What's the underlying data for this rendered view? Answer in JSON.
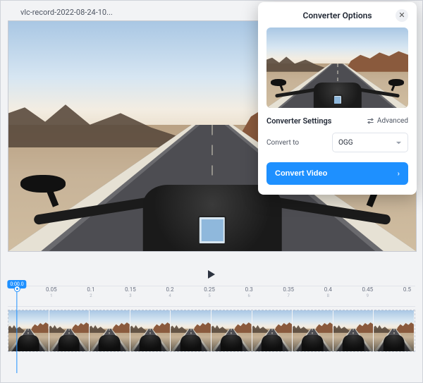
{
  "filename": "vlc-record-2022-08-24-10...",
  "panel": {
    "title": "Converter Options",
    "settings_heading": "Converter Settings",
    "advanced_label": "Advanced",
    "convert_to_label": "Convert to",
    "selected_format": "OGG",
    "cta_label": "Convert Video"
  },
  "timeline": {
    "playhead_label": "0:00.0",
    "ticks": [
      {
        "label": "0.05",
        "sub": "1"
      },
      {
        "label": "0.1",
        "sub": "2"
      },
      {
        "label": "0.15",
        "sub": "3"
      },
      {
        "label": "0.2",
        "sub": "4"
      },
      {
        "label": "0.25",
        "sub": "5"
      },
      {
        "label": "0.3",
        "sub": "6"
      },
      {
        "label": "0.35",
        "sub": "7"
      },
      {
        "label": "0.4",
        "sub": "8"
      },
      {
        "label": "0.45",
        "sub": "9"
      },
      {
        "label": "0.5",
        "sub": ""
      }
    ],
    "frame_count": 10
  }
}
